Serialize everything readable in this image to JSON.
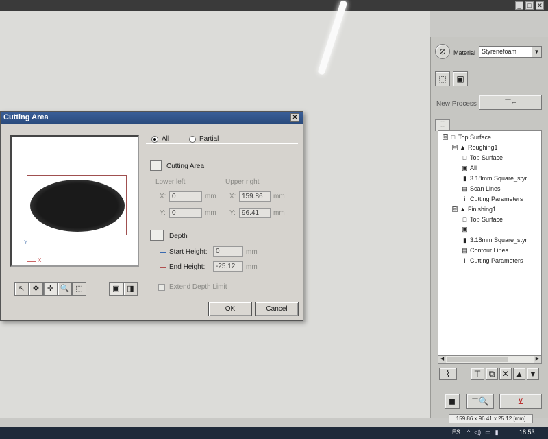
{
  "main_window": {
    "controls": [
      "_",
      "□",
      "✕"
    ]
  },
  "right_panel": {
    "material_label": "Material",
    "material_value": "Styrenefoam",
    "new_process_label": "New Process",
    "tree": [
      {
        "level": 0,
        "label": "Top Surface",
        "expander": "⊟",
        "icon": "□"
      },
      {
        "level": 1,
        "label": "Roughing1",
        "expander": "⊟",
        "icon": "▲"
      },
      {
        "level": 2,
        "label": "Top Surface",
        "icon": "□"
      },
      {
        "level": 2,
        "label": "All",
        "icon": "▣"
      },
      {
        "level": 2,
        "label": "3.18mm Square_styr",
        "icon": "▮"
      },
      {
        "level": 2,
        "label": "Scan Lines",
        "icon": "▤"
      },
      {
        "level": 2,
        "label": "Cutting Parameters",
        "icon": "i"
      },
      {
        "level": 1,
        "label": "Finishing1",
        "expander": "⊟",
        "icon": "▲"
      },
      {
        "level": 2,
        "label": "Top Surface",
        "icon": "□"
      },
      {
        "level": 2,
        "label": "",
        "icon": "▣"
      },
      {
        "level": 2,
        "label": "3.18mm Square_styr",
        "icon": "▮"
      },
      {
        "level": 2,
        "label": "Contour Lines",
        "icon": "▤"
      },
      {
        "level": 2,
        "label": "Cutting Parameters",
        "icon": "i"
      }
    ],
    "status_text": "159.86 x 96.41 x 25.12 [mm]"
  },
  "taskbar": {
    "language": "ES",
    "time": "18:53"
  },
  "dialog": {
    "title": "Cutting Area",
    "close_glyph": "✕",
    "preview_axis_y": "Y",
    "preview_axis_x": "X",
    "radio_all": "All",
    "radio_partial": "Partial",
    "cutting_area_label": "Cutting Area",
    "lower_left_label": "Lower left",
    "upper_right_label": "Upper right",
    "x_label": "X:",
    "y_label": "Y:",
    "lower_left_x": "0",
    "lower_left_y": "0",
    "upper_right_x": "159.86",
    "upper_right_y": "96.41",
    "unit_mm": "mm",
    "depth_label": "Depth",
    "start_height_label": "Start Height:",
    "start_height_value": "0",
    "end_height_label": "End Height:",
    "end_height_value": "-25.12",
    "extend_depth_label": "Extend Depth Limit",
    "ok_label": "OK",
    "cancel_label": "Cancel",
    "tools": [
      "↖",
      "✥",
      "✛",
      "🔍",
      "⬚",
      "▣",
      "◨"
    ]
  }
}
